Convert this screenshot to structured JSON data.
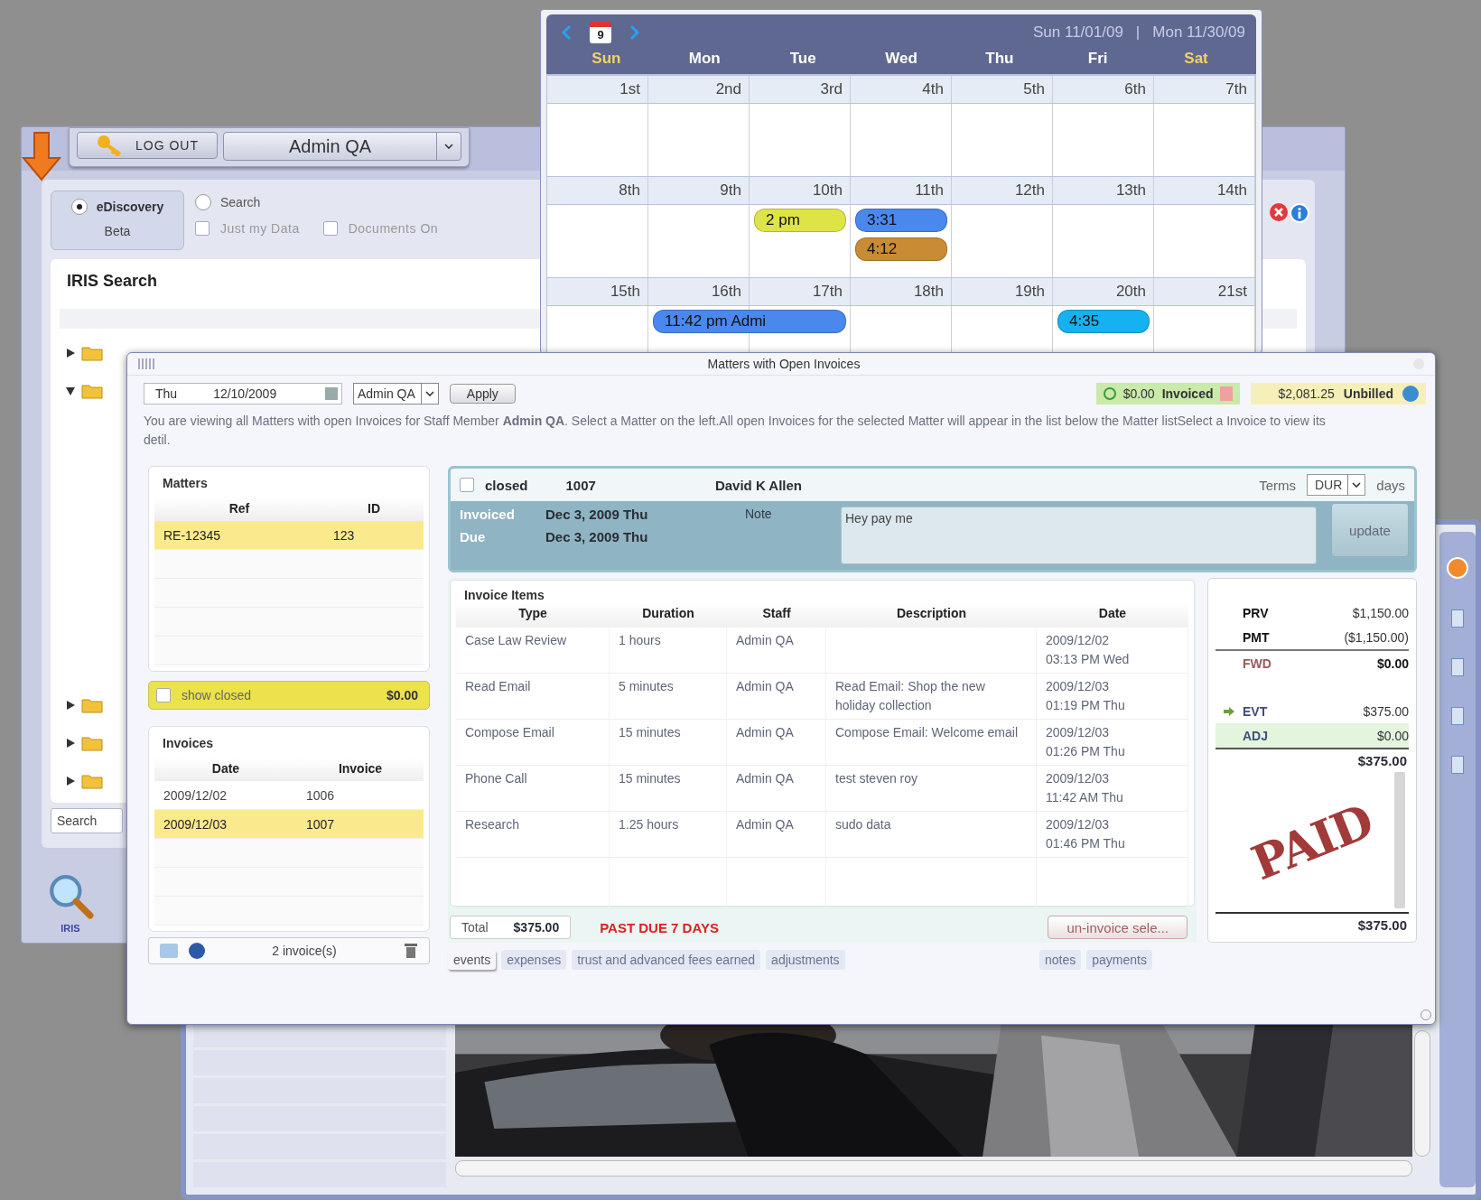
{
  "iris_window": {
    "logout_button": "LOG OUT",
    "user_select": "Admin QA",
    "modes": [
      {
        "label": "eDiscovery",
        "sublabel": "Beta",
        "selected": true
      },
      {
        "label": "Search",
        "selected": false
      }
    ],
    "filters": [
      {
        "label": "Just my Data",
        "checked": false
      },
      {
        "label": "Documents On",
        "checked": false
      }
    ],
    "panel_title": "IRIS Search",
    "tree": [
      {
        "expanded": false
      },
      {
        "expanded": true
      },
      {
        "expanded": false
      },
      {
        "expanded": false
      },
      {
        "expanded": false
      }
    ],
    "search_placeholder": "Search",
    "dock_label": "IRIS"
  },
  "calendar": {
    "today_badge": "9",
    "range_start": "Sun 11/01/09",
    "separator": "|",
    "range_end": "Mon 11/30/09",
    "weekdays": [
      {
        "label": "Sun",
        "weekend": true
      },
      {
        "label": "Mon",
        "weekend": false
      },
      {
        "label": "Tue",
        "weekend": false
      },
      {
        "label": "Wed",
        "weekend": false
      },
      {
        "label": "Thu",
        "weekend": false
      },
      {
        "label": "Fri",
        "weekend": false
      },
      {
        "label": "Sat",
        "weekend": true
      }
    ],
    "weeks": [
      {
        "days": [
          {
            "label": "1st"
          },
          {
            "label": "2nd"
          },
          {
            "label": "3rd"
          },
          {
            "label": "4th"
          },
          {
            "label": "5th"
          },
          {
            "label": "6th"
          },
          {
            "label": "7th"
          }
        ]
      },
      {
        "days": [
          {
            "label": "8th"
          },
          {
            "label": "9th"
          },
          {
            "label": "10th",
            "events": [
              {
                "label": "2 pm",
                "color": "#dfe446",
                "spans_next_day": false
              }
            ]
          },
          {
            "label": "11th",
            "events": [
              {
                "label": "3:31",
                "color": "#4a88ee",
                "spans_next_day": false
              },
              {
                "label": "4:12",
                "color": "#c98c34",
                "spans_next_day": false
              }
            ]
          },
          {
            "label": "12th"
          },
          {
            "label": "13th"
          },
          {
            "label": "14th"
          }
        ]
      },
      {
        "days": [
          {
            "label": "15th"
          },
          {
            "label": "16th",
            "events": [
              {
                "label": "11:42 pm  Admi",
                "color": "#4a88ee",
                "spans_next_day": true
              }
            ]
          },
          {
            "label": "17th"
          },
          {
            "label": "18th"
          },
          {
            "label": "19th"
          },
          {
            "label": "20th",
            "events": [
              {
                "label": "4:35",
                "color": "#16b1f0",
                "spans_next_day": false
              }
            ]
          },
          {
            "label": "21st"
          }
        ]
      }
    ]
  },
  "invoice_window": {
    "title": "Matters with Open Invoices",
    "date_field": {
      "day": "Thu",
      "date": "12/10/2009"
    },
    "staff_select": "Admin QA",
    "apply_button": "Apply",
    "invoiced": {
      "amount": "$0.00",
      "label": "Invoiced"
    },
    "unbilled": {
      "amount": "$2,081.25",
      "label": "Unbilled"
    },
    "info_text": "You are viewing all Matters with open Invoices for Staff Member **Admin QA**. Select a Matter on the left.All open Invoices for the selected Matter will appear in the list below the Matter listSelect a Invoice to view its detil.",
    "matters": {
      "title": "Matters",
      "columns": [
        "Ref",
        "ID"
      ],
      "rows": [
        {
          "cells": [
            "RE-12345",
            "123"
          ],
          "selected": true
        }
      ]
    },
    "show_closed": {
      "label": "show closed",
      "checked": false,
      "amount": "$0.00"
    },
    "invoices": {
      "title": "Invoices",
      "columns": [
        "Date",
        "Invoice"
      ],
      "rows": [
        {
          "cells": [
            "2009/12/02",
            "1006"
          ],
          "selected": false
        },
        {
          "cells": [
            "2009/12/03",
            "1007"
          ],
          "selected": true
        }
      ],
      "count": "2 invoice(s)"
    },
    "detail": {
      "closed": {
        "label": "closed",
        "checked": false
      },
      "number": "1007",
      "client": "David K Allen",
      "terms_label": "Terms",
      "terms_value": "DUR",
      "days_label": "days",
      "invoiced_label": "Invoiced",
      "invoiced_date": "Dec 3, 2009 Thu",
      "due_label": "Due",
      "due_date": "Dec 3, 2009 Thu",
      "note_label": "Note",
      "note": "Hey pay me",
      "update_button": "update"
    },
    "items": {
      "title": "Invoice Items",
      "columns": [
        "Type",
        "Duration",
        "Staff",
        "Description",
        "Date"
      ],
      "rows": [
        {
          "type": "Case Law Review",
          "duration": "1 hours",
          "staff": "Admin QA",
          "date": "2009/12/02",
          "time": "03:13 PM Wed"
        },
        {
          "type": "Read Email",
          "duration": "5 minutes",
          "staff": "Admin QA",
          "description": "Read Email: Shop the new holiday collection",
          "date": "2009/12/03",
          "time": "01:19 PM Thu"
        },
        {
          "type": "Compose Email",
          "duration": "15 minutes",
          "staff": "Admin QA",
          "description": "Compose Email: Welcome email",
          "date": "2009/12/03",
          "time": "01:26 PM Thu"
        },
        {
          "type": "Phone Call",
          "duration": "15 minutes",
          "staff": "Admin QA",
          "description": "test steven roy",
          "date": "2009/12/03",
          "time": "11:42 AM Thu"
        },
        {
          "type": "Research",
          "duration": "1.25 hours",
          "staff": "Admin QA",
          "description": "sudo data",
          "date": "2009/12/03",
          "time": "01:46 PM Thu"
        }
      ]
    },
    "total_label": "Total",
    "total": "$375.00",
    "past_due": "PAST DUE 7 DAYS",
    "uninvoice_button": "un-invoice sele...",
    "tabs": [
      {
        "label": "events",
        "selected": true
      },
      {
        "label": "expenses",
        "selected": false
      },
      {
        "label": "trust and advanced fees earned",
        "selected": false
      },
      {
        "label": "adjustments",
        "selected": false
      }
    ],
    "side_tabs": [
      {
        "label": "notes",
        "selected": false
      },
      {
        "label": "payments",
        "selected": false
      }
    ],
    "summary": {
      "lines": [
        {
          "code": "PRV",
          "amount": "$1,150.00",
          "kind": "plain"
        },
        {
          "code": "PMT",
          "amount": "($1,150.00)",
          "kind": "plain"
        },
        {
          "code": "FWD",
          "amount": "$0.00",
          "kind": "forward"
        },
        {
          "code": "EVT",
          "amount": "$375.00",
          "kind": "current"
        },
        {
          "code": "ADJ",
          "amount": "$0.00",
          "kind": "adjustment"
        }
      ],
      "subtotal": "$375.00",
      "stamp": "PAID",
      "total": "$375.00"
    }
  }
}
